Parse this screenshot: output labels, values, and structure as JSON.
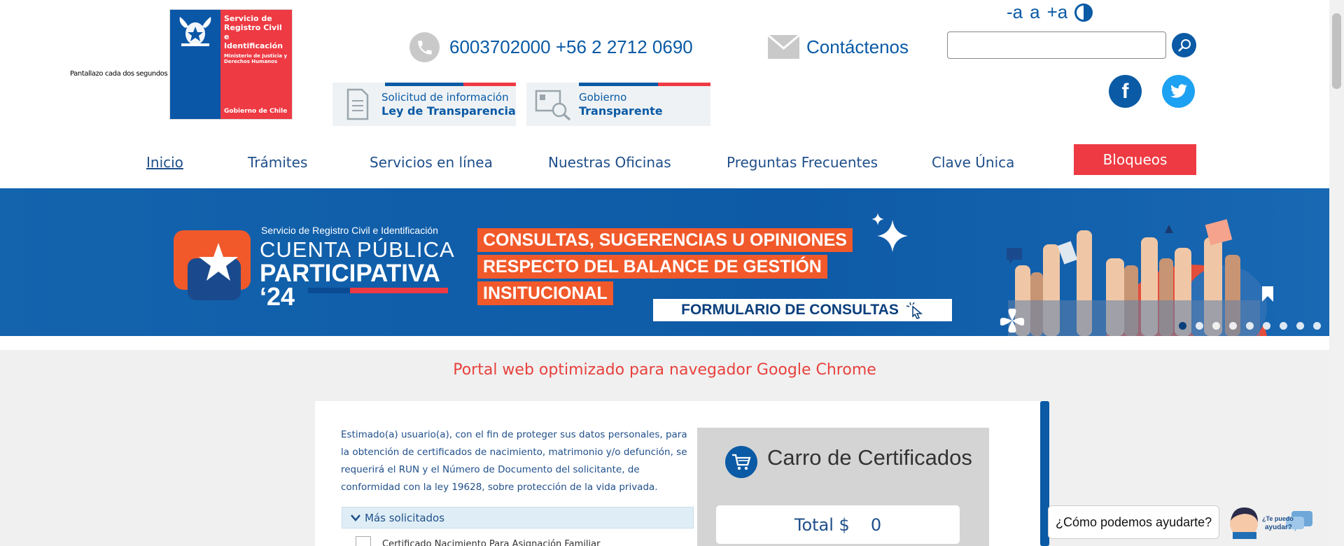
{
  "header": {
    "tagline": "Pantallazo cada dos segundos",
    "logo": {
      "line1": "Servicio de Registro Civil e Identificación",
      "line2": "Ministerio de Justicia y Derechos Humanos",
      "line3": "Gobierno de Chile"
    },
    "phone": "6003702000 +56 2 2712 0690",
    "contact": "Contáctenos",
    "font_controls": {
      "decrease": "-a",
      "normal": "a",
      "increase": "+a"
    },
    "search": {
      "placeholder": ""
    },
    "transparency": {
      "box1_line1": "Solicitud de información",
      "box1_line2": "Ley de Transparencia",
      "box2_line1": "Gobierno",
      "box2_line2": "Transparente"
    },
    "social": {
      "facebook": "f",
      "twitter": "t"
    }
  },
  "nav": {
    "items": [
      {
        "label": "Inicio"
      },
      {
        "label": "Trámites"
      },
      {
        "label": "Servicios en línea"
      },
      {
        "label": "Nuestras Oficinas"
      },
      {
        "label": "Preguntas Frecuentes"
      },
      {
        "label": "Clave Única"
      }
    ],
    "bloqueos": "Bloqueos"
  },
  "banner": {
    "small": "Servicio de Registro Civil e Identificación",
    "cuenta": "CUENTA PÚBLICA",
    "participativa": "PARTICIPATIVA",
    "year": "‘24",
    "lines": [
      "CONSULTAS, SUGERENCIAS U OPINIONES",
      "RESPECTO DEL BALANCE DE GESTIÓN",
      "INSITUCIONAL"
    ],
    "button": "FORMULARIO DE CONSULTAS",
    "slide_count": 9,
    "active_slide": 1
  },
  "notice": "Portal web optimizado para navegador Google Chrome",
  "content": {
    "paragraph": "Estimado(a) usuario(a), con el fin de proteger sus datos personales, para la obtención de certificados de nacimiento, matrimonio y/o defunción, se requerirá el RUN y el Número de Documento del solicitante, de conformidad con la ley 19628, sobre protección de la vida privada.",
    "most_requested": "Más solicitados",
    "first_item": "Certificado Nacimiento Para Asignación Familiar"
  },
  "cart": {
    "title": "Carro de Certificados",
    "total_label": "Total $",
    "total_value": "0"
  },
  "help": {
    "question": "¿Cómo podemos ayudarte?",
    "bot_text": "¿Te puedo ayudar?"
  },
  "colors": {
    "brand_blue": "#0a5aa5",
    "brand_red": "#ee3a43",
    "banner_orange": "#f1592a"
  }
}
